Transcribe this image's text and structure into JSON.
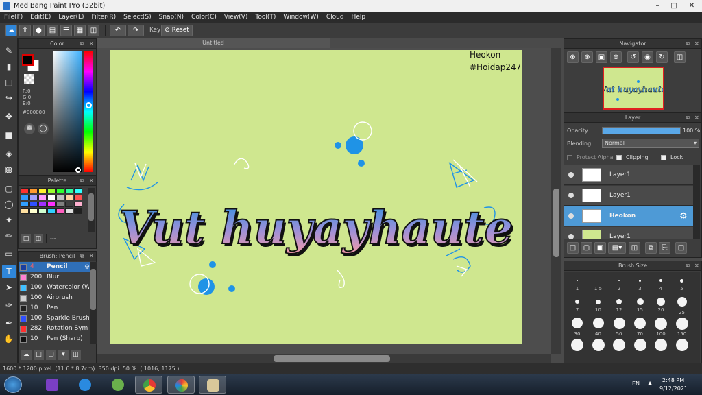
{
  "window": {
    "title": "MediBang Paint Pro (32bit)"
  },
  "menu": [
    "File(F)",
    "Edit(E)",
    "Layer(L)",
    "Filter(R)",
    "Select(S)",
    "Snap(N)",
    "Color(C)",
    "View(V)",
    "Tool(T)",
    "Window(W)",
    "Cloud",
    "Help"
  ],
  "toolbar": {
    "key_label": "Key",
    "reset_label": "Reset"
  },
  "color_panel": {
    "title": "Color",
    "r": "R:0",
    "g": "G:0",
    "b": "B:0",
    "hex": "#000000",
    "fg_color": "#000000",
    "bg_color": "#ffffff"
  },
  "palette_panel": {
    "title": "Palette",
    "swatches": [
      "#ff3030",
      "#ff9a30",
      "#fff030",
      "#9aff30",
      "#30ff30",
      "#30ff9a",
      "#30ffff",
      "#309aff",
      "#a0a0ff",
      "#ff9aff",
      "#ffffff",
      "#c0c0c0",
      "#ffd0a0",
      "#ff5050",
      "#30a0ff",
      "#3050ff",
      "#a030ff",
      "#ff30ff",
      "#808080",
      "#404040",
      "#ffb0d0",
      "#ffe0a0",
      "#ffffd0",
      "#d0ffd0",
      "#30d0ff",
      "#ff60c0",
      "#e0e0e0",
      "#202020"
    ],
    "footer": "---"
  },
  "brush_panel": {
    "title": "Brush: Pencil",
    "items": [
      {
        "size": "4",
        "label": "Pencil",
        "color": "#1a3fa0",
        "active": true
      },
      {
        "size": "200",
        "label": "Blur",
        "color": "#ff80d0"
      },
      {
        "size": "100",
        "label": "Watercolor (W",
        "color": "#40c0ff"
      },
      {
        "size": "100",
        "label": "Airbrush",
        "color": "#d0d0d0"
      },
      {
        "size": "10",
        "label": "Pen",
        "color": "#202020"
      },
      {
        "size": "100",
        "label": "Sparkle Brush",
        "color": "#3050ff"
      },
      {
        "size": "282",
        "label": "Rotation Sym",
        "color": "#ff3030"
      },
      {
        "size": "10",
        "label": "Pen (Sharp)",
        "color": "#101010"
      }
    ]
  },
  "document": {
    "tab": "Untitled",
    "watermark_line1": "Heokon",
    "watermark_line2": "#Hoidap247",
    "lettering": "Vut huyayhaute"
  },
  "navigator": {
    "title": "Navigator"
  },
  "layer_panel": {
    "title": "Layer",
    "opacity_label": "Opacity",
    "opacity_value": "100 %",
    "opacity_fraction": 1.0,
    "blending_label": "Blending",
    "blending_value": "Normal",
    "protect_alpha": "Protect Alpha",
    "clipping": "Clipping",
    "lock": "Lock",
    "layers": [
      {
        "name": "Layer1",
        "selected": false
      },
      {
        "name": "Layer1",
        "selected": false
      },
      {
        "name": "Heokon",
        "selected": true
      },
      {
        "name": "Layer1",
        "selected": false
      }
    ]
  },
  "brush_size_panel": {
    "title": "Brush Size",
    "sizes": [
      "1",
      "1.5",
      "2",
      "3",
      "4",
      "5",
      "7",
      "10",
      "12",
      "15",
      "20",
      "25",
      "30",
      "40",
      "50",
      "70",
      "100",
      "150"
    ]
  },
  "status": {
    "dimensions": "1600 * 1200 pixel",
    "physical": "(11.6 * 8.7cm)",
    "dpi": "350 dpi",
    "zoom": "50 %",
    "coords": "( 1016, 1175 )"
  },
  "taskbar": {
    "language": "EN",
    "time": "2:48 PM",
    "date": "9/12/2021"
  }
}
